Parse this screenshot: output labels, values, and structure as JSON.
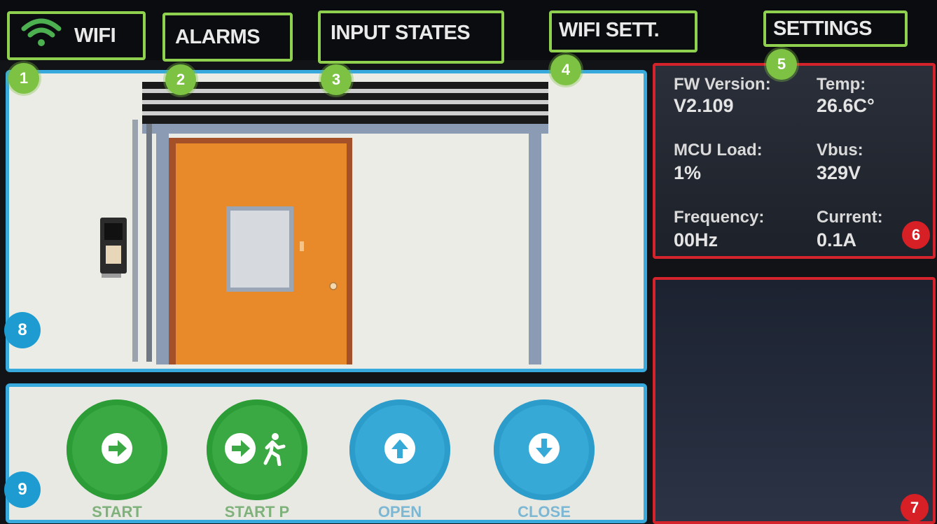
{
  "nav": {
    "wifi_label": "WIFI",
    "alarms_label": "ALARMS",
    "input_states_label": "INPUT STATES",
    "wifi_settings_label": "WIFI SETT.",
    "settings_label": "SETTINGS"
  },
  "markers": [
    "1",
    "2",
    "3",
    "4",
    "5",
    "6",
    "7",
    "8",
    "9"
  ],
  "info": {
    "fw_version_label": "FW Version:",
    "fw_version_value": "V2.109",
    "temp_label": "Temp:",
    "temp_value": "26.6C°",
    "mcu_load_label": "MCU Load:",
    "mcu_load_value": "1%",
    "vbus_label": "Vbus:",
    "vbus_value": "329V",
    "frequency_label": "Frequency:",
    "frequency_value": "00Hz",
    "current_label": "Current:",
    "current_value": "0.1A"
  },
  "controls": {
    "start_label": "START",
    "start_p_label": "START P",
    "open_label": "OPEN",
    "close_label": "CLOSE"
  },
  "icons": {
    "wifi": "wifi-icon",
    "start": "arrow-right-icon",
    "start_p": "arrow-right-pedestrian-icon",
    "open": "arrow-up-icon",
    "close": "arrow-down-icon"
  },
  "colors": {
    "nav_border": "#8fd14f",
    "panel_border_blue": "#38a9dc",
    "panel_border_red": "#d5232b",
    "start_green": "#3aa843",
    "open_blue": "#36a9d6",
    "door_orange": "#e8892a"
  }
}
